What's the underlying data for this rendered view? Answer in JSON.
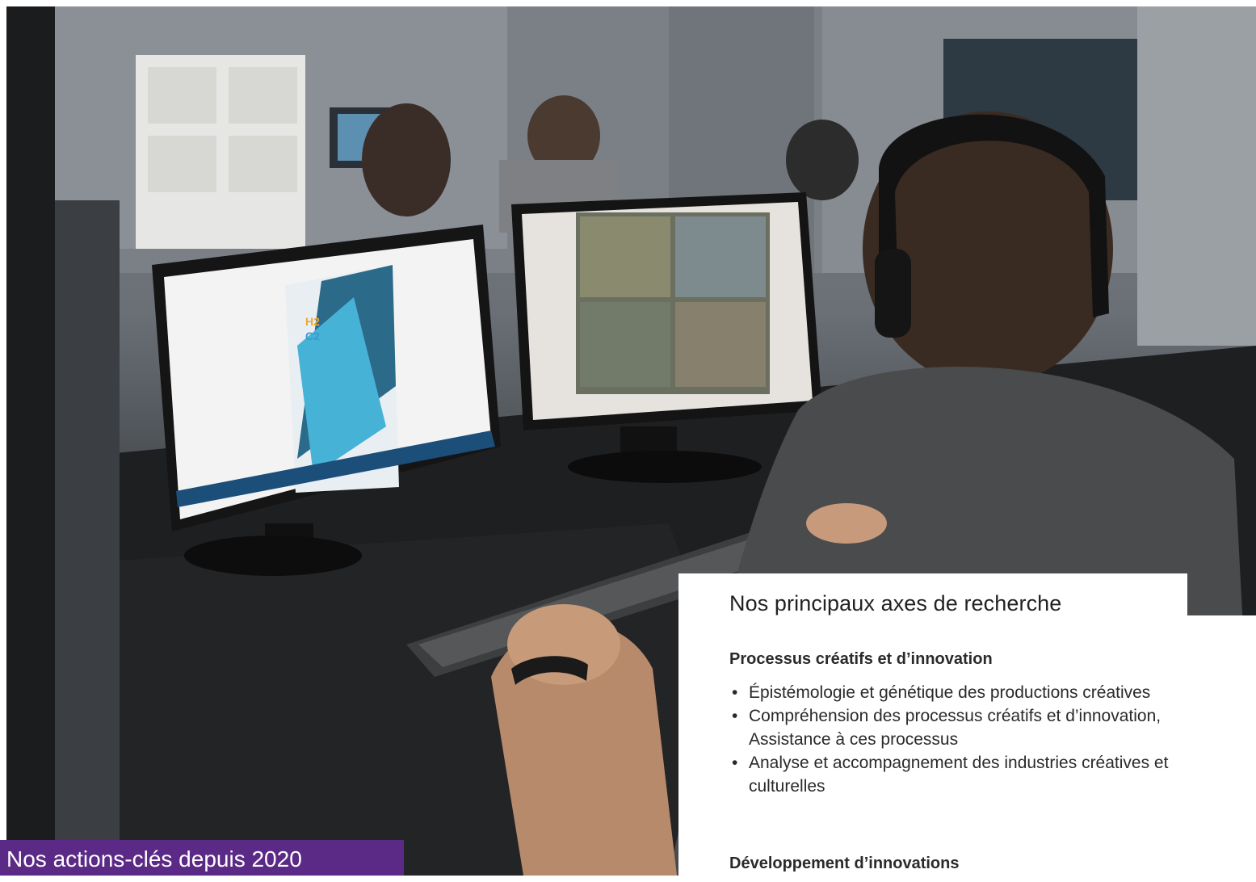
{
  "photo": {
    "description_icon": "photo-lab-scene",
    "screen_left_logo_letters": [
      "H",
      "2",
      "C",
      "2"
    ]
  },
  "research": {
    "heading": "Nos principaux axes de recherche",
    "sections": [
      {
        "title": "Processus créatifs et d’innovation",
        "items": [
          "Épistémologie et génétique des productions créatives",
          "Compréhension des processus créatifs et d’innovation, Assistance à ces processus",
          "Analyse et accompagnement des industries créatives et culturelles"
        ]
      },
      {
        "title": "Développement d’innovations",
        "items": []
      }
    ]
  },
  "banner": {
    "title": "Nos actions-clés depuis 2020"
  },
  "colors": {
    "banner_purple": "#5b2a86",
    "panel_bg": "#ffffff",
    "text_dark": "#222222"
  }
}
